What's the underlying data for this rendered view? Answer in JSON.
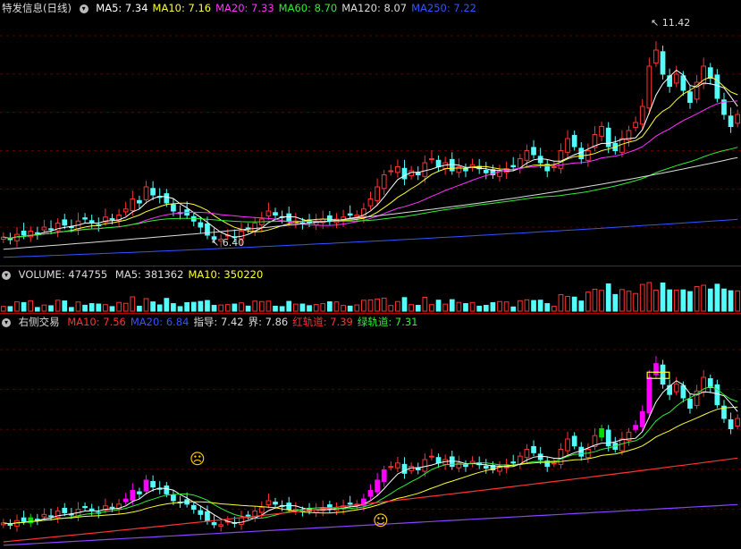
{
  "main": {
    "title": "特发信息(日线)",
    "ma": [
      {
        "label": "MA5: 7.34",
        "color": "#ffffff"
      },
      {
        "label": "MA10: 7.16",
        "color": "#ffff33"
      },
      {
        "label": "MA20: 7.33",
        "color": "#ff33ff"
      },
      {
        "label": "MA60: 8.70",
        "color": "#33ee33"
      },
      {
        "label": "MA120: 8.07",
        "color": "#dddddd"
      },
      {
        "label": "MA250: 7.22",
        "color": "#3355ff"
      }
    ],
    "high_label": "11.42",
    "low_label": "6.40"
  },
  "volume": {
    "label": "VOLUME: 474755",
    "ma": [
      {
        "label": "MA5: 381362",
        "color": "#dddddd"
      },
      {
        "label": "MA10: 350220",
        "color": "#ffff33"
      }
    ]
  },
  "indicator": {
    "title": "右侧交易",
    "items": [
      {
        "label": "MA10: 7.56",
        "color": "#ff3333"
      },
      {
        "label": "MA20: 6.84",
        "color": "#3355ff"
      },
      {
        "label": "指导: 7.42",
        "color": "#dddddd"
      },
      {
        "label": "界: 7.86",
        "color": "#dddddd"
      },
      {
        "label": "红轨道: 7.39",
        "color": "#ff3333"
      },
      {
        "label": "绿轨道: 7.31",
        "color": "#33ee33"
      }
    ],
    "sad_icon": "☹",
    "happy_icon": "☺"
  },
  "colors": {
    "up": "#ff3232",
    "down": "#54fcfc",
    "grid": "#5a0000",
    "sep": "#b00000",
    "ind_up": "#ff00ff",
    "ind_green": "#00dd00"
  },
  "chart_data": {
    "type": "candlestick",
    "price_range": [
      6.0,
      12.0
    ],
    "high_point": 11.42,
    "low_point": 6.4,
    "closes": [
      6.55,
      6.5,
      6.62,
      6.6,
      6.7,
      6.65,
      6.8,
      6.75,
      6.9,
      6.85,
      6.8,
      6.95,
      7.0,
      6.9,
      6.85,
      7.05,
      7.0,
      7.1,
      7.25,
      7.5,
      7.4,
      7.8,
      7.6,
      7.55,
      7.4,
      7.2,
      7.15,
      7.1,
      6.95,
      6.8,
      6.6,
      6.5,
      6.5,
      6.6,
      6.55,
      6.7,
      6.75,
      6.9,
      7.0,
      7.2,
      7.1,
      7.05,
      6.95,
      6.95,
      6.9,
      6.9,
      6.95,
      7.0,
      6.95,
      7.0,
      7.05,
      7.1,
      7.1,
      7.25,
      7.5,
      7.8,
      8.1,
      8.2,
      8.3,
      8.0,
      8.2,
      8.1,
      8.4,
      8.5,
      8.3,
      8.4,
      8.2,
      8.3,
      8.2,
      8.35,
      8.25,
      8.15,
      8.1,
      8.2,
      8.25,
      8.3,
      8.5,
      8.7,
      8.6,
      8.4,
      8.2,
      8.3,
      8.7,
      9.0,
      8.8,
      8.5,
      8.7,
      9.1,
      9.3,
      8.8,
      8.7,
      9.0,
      9.2,
      9.4,
      9.8,
      10.8,
      11.2,
      10.6,
      10.3,
      10.6,
      10.2,
      9.9,
      10.4,
      10.8,
      10.5,
      10.0,
      9.6,
      9.3,
      9.6
    ],
    "volume_range": [
      0,
      1000000
    ],
    "volume_current": 474755
  }
}
